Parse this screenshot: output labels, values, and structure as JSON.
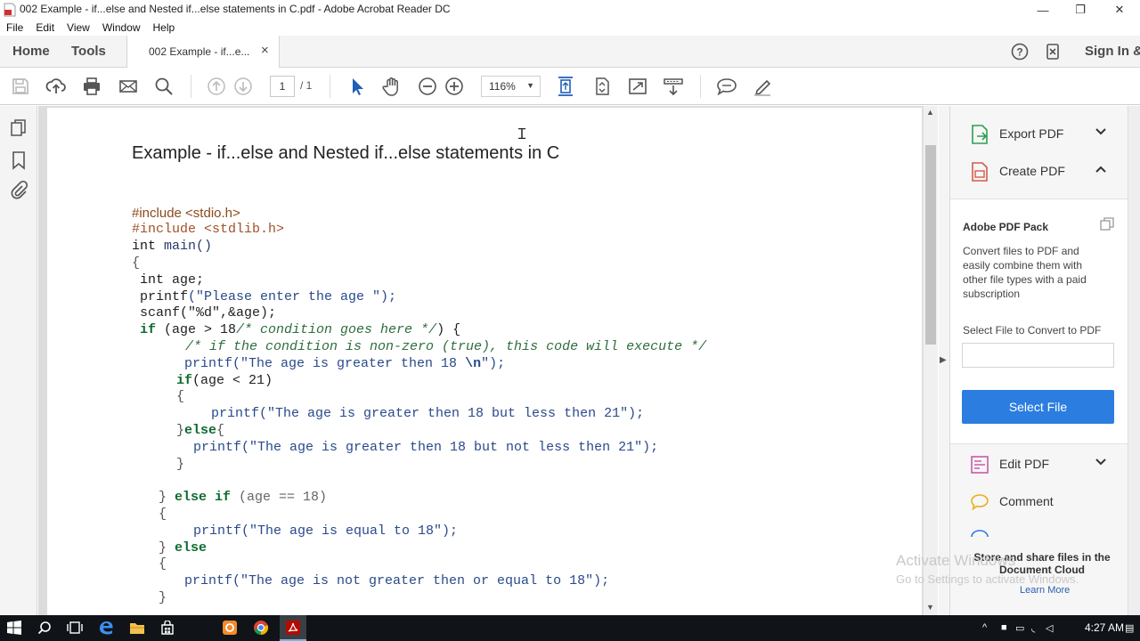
{
  "window": {
    "title": "002 Example -  if...else and Nested if...else statements in C.pdf - Adobe Acrobat Reader DC",
    "controls": {
      "minimize": "—",
      "restore": "❐",
      "close": "✕"
    }
  },
  "menu": [
    "File",
    "Edit",
    "View",
    "Window",
    "Help"
  ],
  "tabs": {
    "home": "Home",
    "tools": "Tools",
    "document": "002 Example -  if...e...",
    "close": "×",
    "sign_in": "Sign In &"
  },
  "toolbar": {
    "page_current": "1",
    "page_total": "/ 1",
    "zoom": "116%",
    "zoom_arrow": "▼"
  },
  "document": {
    "title": "Example -  if...else and Nested if...else statements in C",
    "code": {
      "inc1": "#include <stdio.h>",
      "inc2": "#include <stdlib.h>",
      "main_kw": "int",
      "main_fn": " main()",
      "open": "{",
      "l_int_kw": " int",
      "l_int_rest": " age;",
      "l_printf": " printf",
      "l_printf_str": "(\"Please enter the age \");",
      "l_scanf": " scanf(\"%d\",&age);",
      "l_if_kw": " if",
      "l_if_cond": " (age > 18",
      "l_if_cmt": "/* condition goes here */",
      "l_if_open": ") {",
      "l_cmt2": "/* if the condition is non-zero (true), this code will execute */",
      "l_pf1": "printf(\"The age is greater then 18 ",
      "l_pf1_n": "\\n",
      "l_pf1_end": "\");",
      "l_if2_kw": "if",
      "l_if2_cond": "(age < 21)",
      "l_br1": "{",
      "l_pf2": "printf(\"The age is greater then 18 but less then 21\");",
      "l_close_else_br": "}",
      "l_else_kw": "else",
      "l_else_br": "{",
      "l_pf3": "printf(\"The age is greater then 18 but not less then 21\");",
      "l_br2": "}",
      "l_elseif_br": "}",
      "l_elseif_kw": " else if",
      "l_elseif_cond": " (age == 18)",
      "l_br3": "{",
      "l_pf4": "printf(\"The age is equal to 18\");",
      "l_else2_br": "}",
      "l_else2_kw": " else",
      "l_br4": "{",
      "l_pf5": "printf(\"The age is not greater then or equal to 18\");",
      "l_br5": "}"
    }
  },
  "right_panel": {
    "export_pdf": "Export PDF",
    "create_pdf": "Create PDF",
    "pack_heading": "Adobe PDF Pack",
    "pack_desc": "Convert files to PDF and easily combine them with other file types with a paid subscription",
    "select_label": "Select File to Convert to PDF",
    "select_button": "Select File",
    "edit_pdf": "Edit PDF",
    "comment": "Comment",
    "store_share": "Store and share files in the Document Cloud",
    "learn_more": "Learn More"
  },
  "watermark": {
    "line1": "Activate Windows",
    "line2": "Go to Settings to activate Windows."
  },
  "taskbar": {
    "time": "4:27 AM"
  },
  "colors": {
    "accent_blue": "#2b7de0",
    "pdf_red": "#d32f2f",
    "taskbar": "#101418"
  }
}
